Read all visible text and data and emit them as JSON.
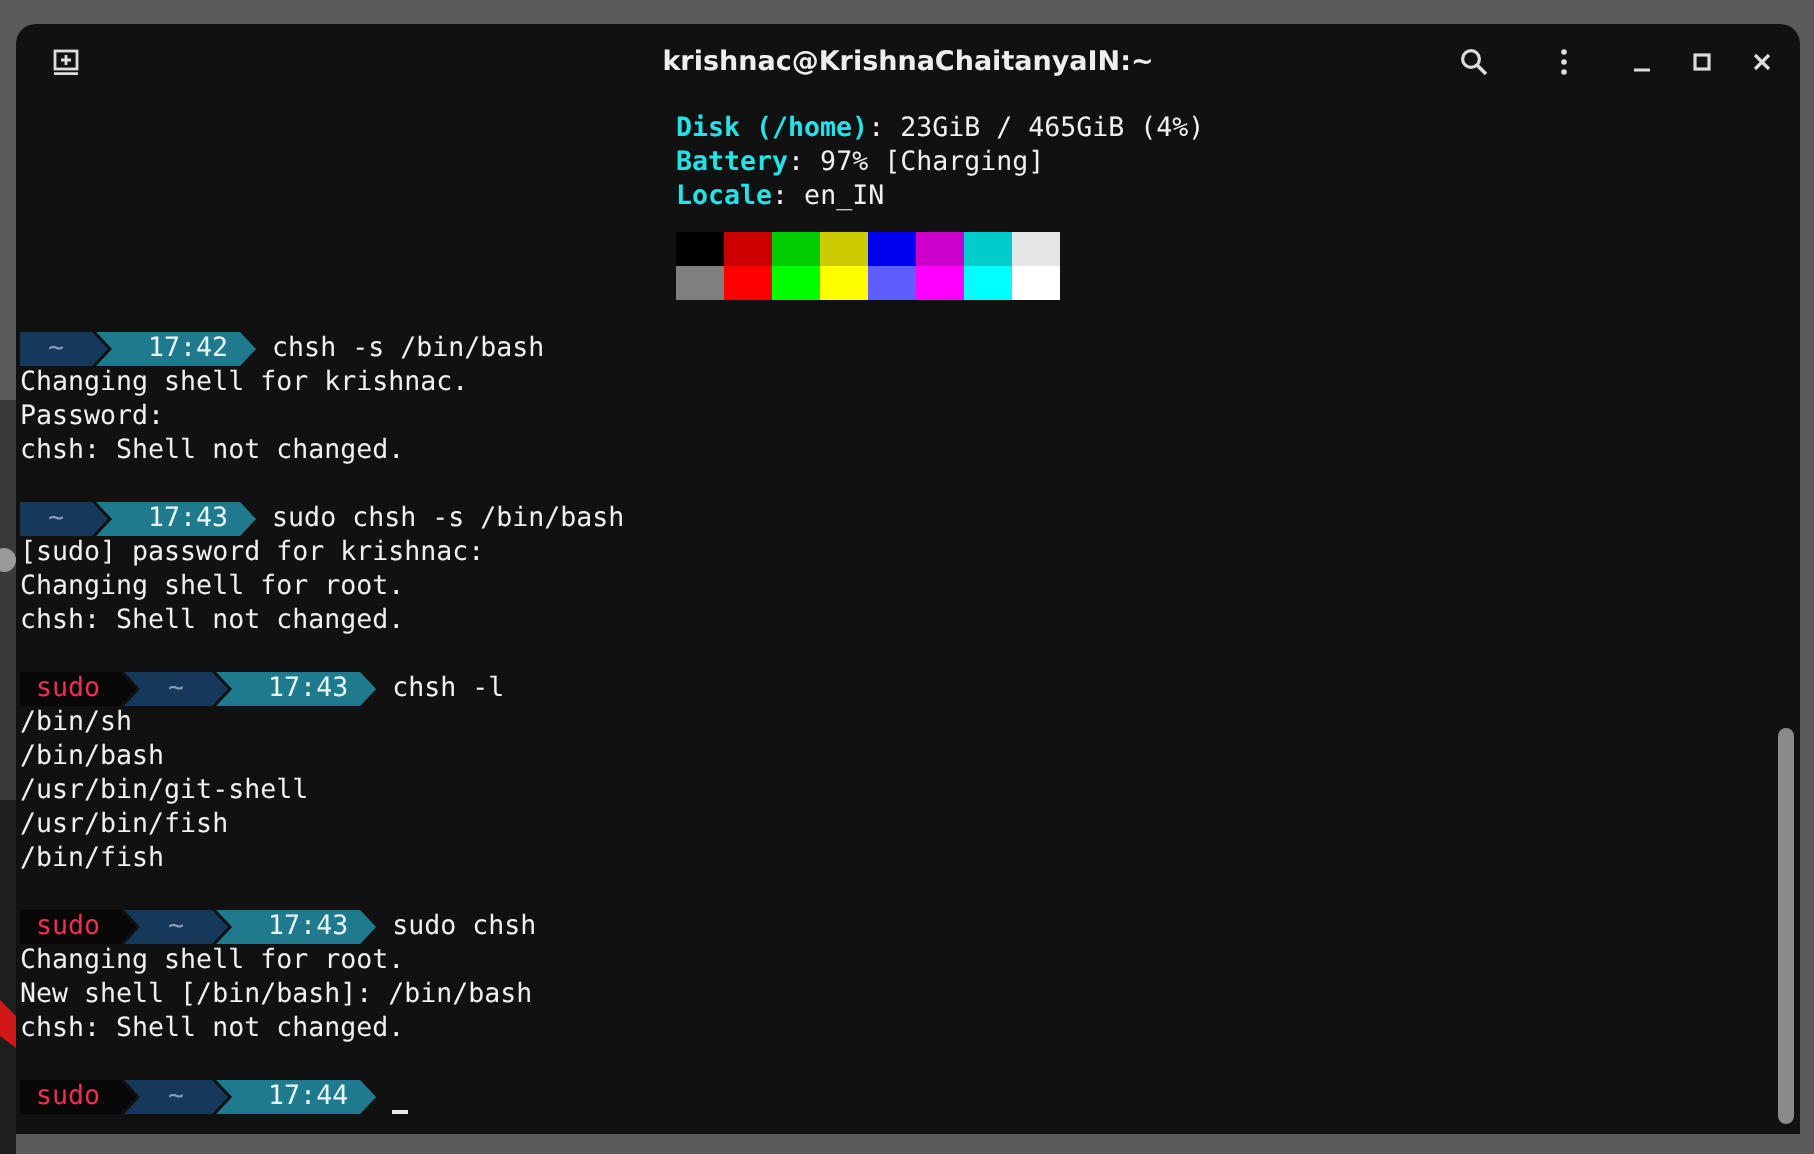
{
  "window": {
    "title": "krishnac@KrishnaChaitanyaIN:~"
  },
  "info_lines": [
    {
      "label": "Disk (/home)",
      "value": ": 23GiB / 465GiB (4%)"
    },
    {
      "label": "Battery",
      "value": ": 97% [Charging]"
    },
    {
      "label": "Locale",
      "value": ": en_IN"
    }
  ],
  "palette": [
    [
      {
        "color": "#000000"
      },
      {
        "color": "#cc0000"
      },
      {
        "color": "#00cc00"
      },
      {
        "color": "#cccc00"
      },
      {
        "color": "#0000ee"
      },
      {
        "color": "#cc00cc"
      },
      {
        "color": "#00cccc"
      },
      {
        "color": "#e5e5e5"
      }
    ],
    [
      {
        "color": "#7f7f7f"
      },
      {
        "color": "#ff0000"
      },
      {
        "color": "#00ff00"
      },
      {
        "color": "#ffff00"
      },
      {
        "color": "#5c5cff"
      },
      {
        "color": "#ff00ff"
      },
      {
        "color": "#00ffff"
      },
      {
        "color": "#ffffff"
      }
    ]
  ],
  "blocks": [
    {
      "prompt": [
        {
          "kind": "dir",
          "text": "~"
        },
        {
          "kind": "time",
          "text": "17:42"
        }
      ],
      "command": "chsh -s /bin/bash",
      "output": [
        "Changing shell for krishnac.",
        "Password:",
        "chsh: Shell not changed."
      ]
    },
    {
      "prompt": [
        {
          "kind": "dir",
          "text": "~"
        },
        {
          "kind": "time",
          "text": "17:43"
        }
      ],
      "command": "sudo chsh -s /bin/bash",
      "output": [
        "[sudo] password for krishnac:",
        "Changing shell for root.",
        "chsh: Shell not changed."
      ]
    },
    {
      "prompt": [
        {
          "kind": "sudo",
          "text": "sudo"
        },
        {
          "kind": "dir",
          "text": "~"
        },
        {
          "kind": "time",
          "text": "17:43"
        }
      ],
      "command": "chsh -l",
      "output": [
        "/bin/sh",
        "/bin/bash",
        "/usr/bin/git-shell",
        "/usr/bin/fish",
        "/bin/fish"
      ]
    },
    {
      "prompt": [
        {
          "kind": "sudo",
          "text": "sudo"
        },
        {
          "kind": "dir",
          "text": "~"
        },
        {
          "kind": "time",
          "text": "17:43"
        }
      ],
      "command": "sudo chsh",
      "output": [
        "Changing shell for root.",
        "New shell [/bin/bash]: /bin/bash",
        "chsh: Shell not changed."
      ]
    },
    {
      "prompt": [
        {
          "kind": "sudo",
          "text": "sudo"
        },
        {
          "kind": "dir",
          "text": "~"
        },
        {
          "kind": "time",
          "text": "17:44"
        }
      ],
      "cursor": true
    }
  ]
}
